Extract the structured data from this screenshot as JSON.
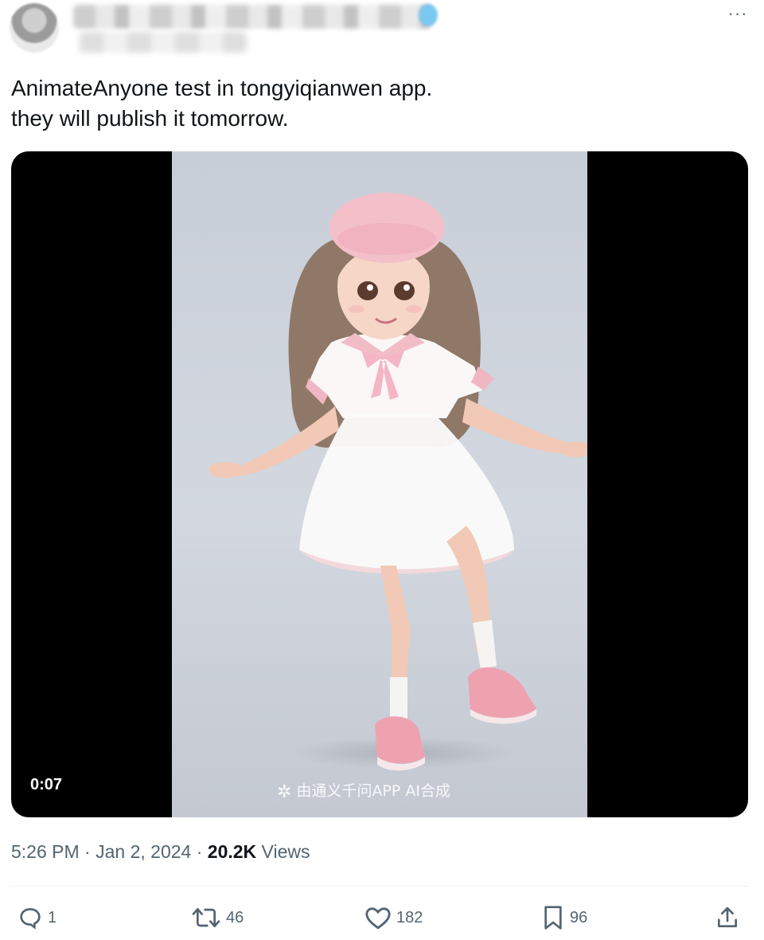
{
  "tweet": {
    "more_label": "···",
    "lines": [
      "AnimateAnyone test in tongyiqianwen app.",
      "they will publish it tomorrow."
    ],
    "media": {
      "duration": "0:07",
      "watermark": "由通义千问APP AI合成"
    },
    "meta": {
      "time": "5:26 PM",
      "sep": "·",
      "date": "Jan 2, 2024",
      "views_count": "20.2K",
      "views_label": "Views"
    },
    "actions": {
      "replies": "1",
      "retweets": "46",
      "likes": "182",
      "bookmarks": "96"
    }
  },
  "icons": [
    "reply-icon",
    "retweet-icon",
    "like-icon",
    "bookmark-icon",
    "share-icon",
    "more-icon"
  ],
  "colors": {
    "muted": "#536471",
    "text": "#0f1419",
    "media_bg": "#000000"
  }
}
